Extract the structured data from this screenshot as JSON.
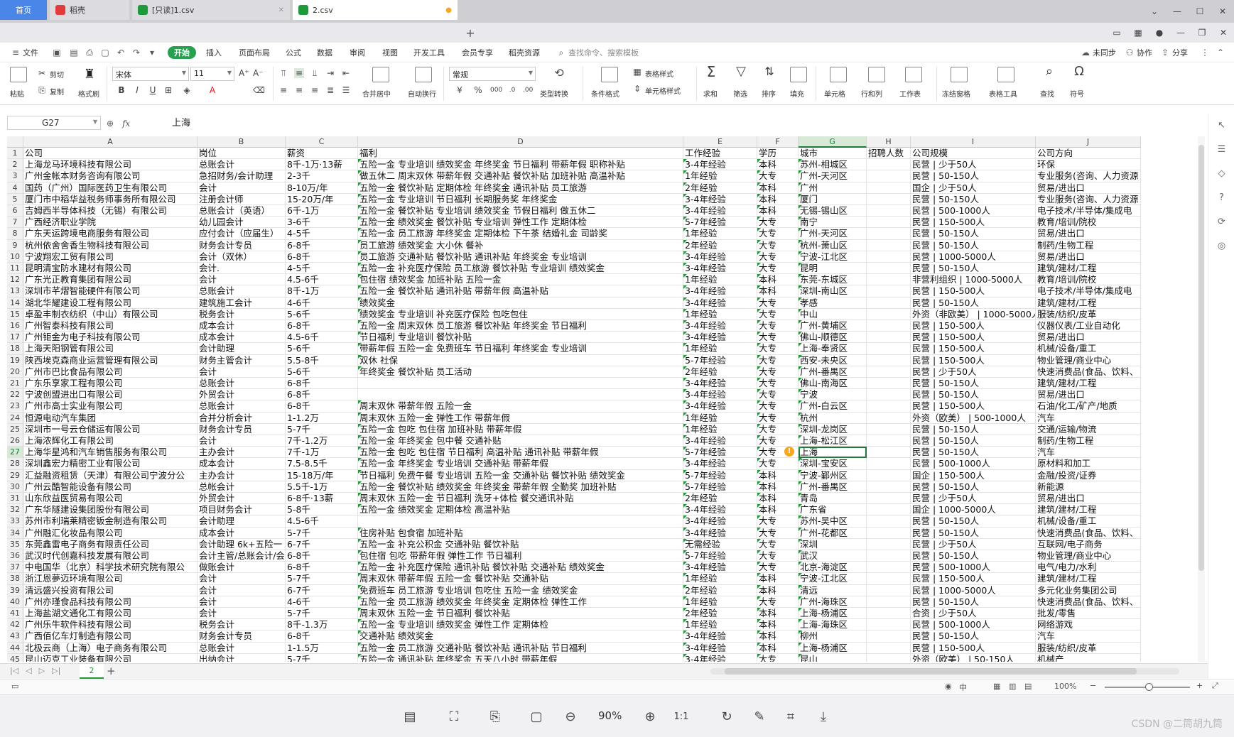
{
  "tabs": {
    "home": "首页",
    "docer": "稻壳",
    "file1": "[只读]1.csv",
    "file2": "2.csv"
  },
  "menu": {
    "file": "文件",
    "items": [
      "开始",
      "插入",
      "页面布局",
      "公式",
      "数据",
      "审阅",
      "视图",
      "开发工具",
      "会员专享",
      "稻壳资源"
    ],
    "search": "查找命令、搜索模板",
    "unsynced": "未同步",
    "collab": "协作",
    "share": "分享"
  },
  "ribbon": {
    "paste": "粘贴",
    "cut": "剪切",
    "copy": "复制",
    "format_painter": "格式刷",
    "font_name": "宋体",
    "font_size": "11",
    "merge": "合并居中",
    "wrap": "自动换行",
    "number_format": "常规",
    "type_convert": "类型转换",
    "cond_format": "条件格式",
    "table_style": "表格样式",
    "cell_style": "单元格样式",
    "sum": "求和",
    "filter": "筛选",
    "sort": "排序",
    "fill": "填充",
    "cell": "单元格",
    "rowcol": "行和列",
    "sheet": "工作表",
    "freeze": "冻结窗格",
    "table_tools": "表格工具",
    "find": "查找",
    "symbol": "符号"
  },
  "formula_bar": {
    "name_box": "G27",
    "content": "上海"
  },
  "columns": [
    "A",
    "B",
    "C",
    "D",
    "E",
    "F",
    "G",
    "H",
    "I",
    "J"
  ],
  "selected_column": "G",
  "rows": [
    [
      "公司",
      "岗位",
      "薪资",
      "福利",
      "工作经验",
      "学历",
      "城市",
      "招聘人数",
      "公司规模",
      "公司方向"
    ],
    [
      "上海龙马环境科技有限公司",
      "总账会计",
      "8千-1万·13薪",
      "五险一金 专业培训 绩效奖金 年终奖金 节日福利 带薪年假 职称补贴",
      "3-4年经验",
      "本科",
      "苏州-相城区",
      "",
      "民营 | 少于50人",
      "环保"
    ],
    [
      "广州金帐本财务咨询有限公司",
      "急招财务/会计助理",
      "2-3千",
      "做五休二 周末双休 带薪年假 交通补贴 餐饮补贴 加班补贴 高温补贴",
      "1年经验",
      "大专",
      "广州-天河区",
      "",
      "民营 | 50-150人",
      "专业服务(咨询、人力资源"
    ],
    [
      "国药（广州）国际医药卫生有限公司",
      "会计",
      "8-10万/年",
      "五险一金 餐饮补贴 定期体检 年终奖金 通讯补贴 员工旅游",
      "2年经验",
      "本科",
      "广州",
      "",
      "国企 | 少于50人",
      "贸易/进出口"
    ],
    [
      "厦门市中稻华益税务师事务所有限公司",
      "注册会计师",
      "15-20万/年",
      "五险一金 专业培训 节日福利 长期服务奖 年终奖金",
      "3-4年经验",
      "本科",
      "厦门",
      "",
      "民营 | 50-150人",
      "专业服务(咨询、人力资源"
    ],
    [
      "吉姆西半导体科技（无锡）有限公司",
      "总账会计（英语）",
      "6千-1万",
      "五险一金 餐饮补贴 专业培训 绩效奖金 节假日福利 做五休二",
      "3-4年经验",
      "本科",
      "无锡-锡山区",
      "",
      "民营 | 500-1000人",
      "电子技术/半导体/集成电"
    ],
    [
      "广西经济职业学院",
      "幼儿园会计",
      "3-6千",
      "五险一金 绩效奖金 餐饮补贴 专业培训 弹性工作 定期体检",
      "5-7年经验",
      "大专",
      "南宁",
      "",
      "民营 | 150-500人",
      "教育/培训/院校"
    ],
    [
      "广东天运跨境电商服务有限公司",
      "应付会计（应届生）",
      "4-5千",
      "五险一金 员工旅游 年终奖金 定期体检 下午茶 结婚礼金 司龄奖",
      "1年经验",
      "大专",
      "广州-天河区",
      "",
      "民营 | 50-150人",
      "贸易/进出口"
    ],
    [
      "杭州依舍舍香生物科技有限公司",
      "财务会计专员",
      "6-8千",
      "员工旅游 绩效奖金 大小休 餐补",
      "2年经验",
      "大专",
      "杭州-萧山区",
      "",
      "民营 | 50-150人",
      "制药/生物工程"
    ],
    [
      "宁波翔宏工贸有限公司",
      "会计（双休）",
      "6-8千",
      "员工旅游 交通补贴 餐饮补贴 通讯补贴 年终奖金 专业培训",
      "3-4年经验",
      "大专",
      "宁波-江北区",
      "",
      "民营 | 1000-5000人",
      "贸易/进出口"
    ],
    [
      "昆明清宝防水建材有限公司",
      "会计.",
      "4-5千",
      "五险一金 补充医疗保险 员工旅游 餐饮补贴 专业培训 绩效奖金",
      "3-4年经验",
      "大专",
      "昆明",
      "",
      "民营 | 50-150人",
      "建筑/建材/工程"
    ],
    [
      "广东光正教育集团有限公司",
      "会计",
      "4.5-6千",
      "包住宿 绩效奖金 加班补贴 五险一金",
      "1年经验",
      "本科",
      "东莞-东城区",
      "",
      "非营利组织 | 1000-5000人",
      "教育/培训/院校"
    ],
    [
      "深圳市芊熠智能硬件有限公司",
      "总账会计",
      "8千-1万",
      "五险一金 餐饮补贴 通讯补贴 带薪年假 高温补贴",
      "3-4年经验",
      "本科",
      "深圳-南山区",
      "",
      "民营 | 150-500人",
      "电子技术/半导体/集成电"
    ],
    [
      "湖北华耀建设工程有限公司",
      "建筑施工会计",
      "4-6千",
      "绩效奖金",
      "3-4年经验",
      "大专",
      "孝感",
      "",
      "民营 | 50-150人",
      "建筑/建材/工程"
    ],
    [
      "卓盈丰制衣纺织（中山）有限公司",
      "税务会计",
      "5-6千",
      "绩效奖金 专业培训 补充医疗保险 包吃包住",
      "1年经验",
      "大专",
      "中山",
      "",
      "外资（非欧美） | 1000-5000人",
      "服装/纺织/皮革"
    ],
    [
      "广州智泰科技有限公司",
      "成本会计",
      "6-8千",
      "五险一金 周末双休 员工旅游 餐饮补贴 年终奖金 节日福利",
      "3-4年经验",
      "大专",
      "广州-黄埔区",
      "",
      "民营 | 150-500人",
      "仪器仪表/工业自动化"
    ],
    [
      "广州钜金为电子科技有限公司",
      "成本会计",
      "4.5-6千",
      "节日福利 专业培训 餐饮补贴",
      "3-4年经验",
      "大专",
      "佛山-顺德区",
      "",
      "民营 | 150-500人",
      "贸易/进出口"
    ],
    [
      "上海天阳钢管有限公司",
      "会计助理",
      "5-6千",
      "带薪年假 五险一金 免费班车 节日福利 年终奖金 专业培训",
      "1年经验",
      "大专",
      "上海-奉贤区",
      "",
      "民营 | 150-500人",
      "机械/设备/重工"
    ],
    [
      "陕西埃克森商业运营管理有限公司",
      "财务主管会计",
      "5.5-8千",
      "双休 社保",
      "5-7年经验",
      "大专",
      "西安-未央区",
      "",
      "民营 | 150-500人",
      "物业管理/商业中心"
    ],
    [
      "广州市巴比食品有限公司",
      "会计",
      "5-6千",
      "年终奖金 餐饮补贴 员工活动",
      "2年经验",
      "大专",
      "广州-番禺区",
      "",
      "民营 | 少于50人",
      "快速消费品(食品、饮料、"
    ],
    [
      "广东乐享家工程有限公司",
      "总账会计",
      "6-8千",
      "",
      "3-4年经验",
      "大专",
      "佛山-南海区",
      "",
      "民营 | 50-150人",
      "建筑/建材/工程"
    ],
    [
      "宁波创盟进出口有限公司",
      "外贸会计",
      "6-8千",
      "",
      "3-4年经验",
      "大专",
      "宁波",
      "",
      "民营 | 50-150人",
      "贸易/进出口"
    ],
    [
      "广州市高士实业有限公司",
      "总账会计",
      "6-8千",
      "周末双休 带薪年假 五险一金",
      "3-4年经验",
      "大专",
      "广州-白云区",
      "",
      "民营 | 150-500人",
      "石油/化工/矿产/地质"
    ],
    [
      "恒源电动汽车集团",
      "合并分析会计",
      "1-1.2万",
      "周末双休 五险一金 弹性工作 带薪年假",
      "1年经验",
      "大专",
      "杭州",
      "",
      "外资（欧美） | 500-1000人",
      "汽车"
    ],
    [
      "深圳市一号云仓储运有限公司",
      "财务会计专员",
      "5-7千",
      "五险一金 包吃 包住宿 加班补贴 带薪年假",
      "1年经验",
      "大专",
      "深圳-龙岗区",
      "",
      "民营 | 50-150人",
      "交通/运输/物流"
    ],
    [
      "上海浓辉化工有限公司",
      "会计",
      "7千-1.2万",
      "五险一金 年终奖金 包中餐 交通补贴",
      "3-4年经验",
      "大专",
      "上海-松江区",
      "",
      "民营 | 50-150人",
      "制药/生物工程"
    ],
    [
      "上海华星鸿和汽车销售服务有限公司",
      "主办会计",
      "7千-1万",
      "五险一金 包吃 包住宿 节日福利 高温补贴 通讯补贴 带薪年假",
      "5-7年经验",
      "大专",
      "上海",
      "",
      "民营 | 50-150人",
      "汽车"
    ],
    [
      "深圳鑫宏力精密工业有限公司",
      "成本会计",
      "7.5-8.5千",
      "五险一金 年终奖金 专业培训 交通补贴 带薪年假",
      "3-4年经验",
      "大专",
      "深圳-宝安区",
      "",
      "民营 | 500-1000人",
      "原材料和加工"
    ],
    [
      "汇益融资租赁（天津）有限公司宁波分公",
      "主办会计",
      "15-18万/年",
      "节日福利 免费午餐 专业培训 五险一金 交通补贴 餐饮补贴 绩效奖金",
      "5-7年经验",
      "本科",
      "宁波-鄞州区",
      "",
      "国企 | 150-500人",
      "金融/投资/证券"
    ],
    [
      "广州云酷智能设备有限公司",
      "总帐会计",
      "5.5千-1万",
      "五险一金 餐饮补贴 绩效奖金 年终奖金 带薪年假 全勤奖 加班补贴",
      "5-7年经验",
      "本科",
      "广州-番禺区",
      "",
      "民营 | 50-150人",
      "新能源"
    ],
    [
      "山东欣益医贸易有限公司",
      "外贸会计",
      "6-8千·13薪",
      "周末双休 五险一金 节日福利 洗牙+体检 餐交通讯补贴",
      "2年经验",
      "本科",
      "青岛",
      "",
      "民营 | 少于50人",
      "贸易/进出口"
    ],
    [
      "广东华隧建设集团股份有限公司",
      "项目财务会计",
      "5-8千",
      "五险一金 绩效奖金 定期体检 高温补贴",
      "3-4年经验",
      "本科",
      "广东省",
      "",
      "国企 | 1000-5000人",
      "建筑/建材/工程"
    ],
    [
      "苏州市利瑞莱精密钣金制造有限公司",
      "会计助理",
      "4.5-6千",
      "",
      "3-4年经验",
      "大专",
      "苏州-吴中区",
      "",
      "民营 | 50-150人",
      "机械/设备/重工"
    ],
    [
      "广州融汇化妆品有限公司",
      "成本会计",
      "5-7千",
      "住房补贴 包食宿 加班补贴",
      "3-4年经验",
      "大专",
      "广州-花都区",
      "",
      "民营 | 50-150人",
      "快速消费品(食品、饮料、"
    ],
    [
      "东莞鑫雷电子商务有限责任公司",
      "会计助理 6k+五险一",
      "6-7千",
      "五险一金 补充公积金 交通补贴 餐饮补贴",
      "无需经验",
      "大专",
      "深圳",
      "",
      "民营 | 少于50人",
      "互联网/电子商务"
    ],
    [
      "武汉时代创嘉科技发展有限公司",
      "会计主管/总账会计/会",
      "6-8千",
      "包住宿 包吃 带薪年假 弹性工作 节日福利",
      "5-7年经验",
      "大专",
      "武汉",
      "",
      "民营 | 50-150人",
      "物业管理/商业中心"
    ],
    [
      "中电国华（北京）科学技术研究院有限公",
      "做账会计",
      "6-8千",
      "五险一金 补充医疗保险 通讯补贴 餐饮补贴 交通补贴 绩效奖金",
      "3-4年经验",
      "大专",
      "北京-海淀区",
      "",
      "民营 | 500-1000人",
      "电气/电力/水利"
    ],
    [
      "浙江恩夢迈环境有限公司",
      "会计",
      "5-7千",
      "周末双休 带薪年假 五险一金 餐饮补贴 交通补贴",
      "1年经验",
      "本科",
      "宁波-江北区",
      "",
      "民营 | 150-500人",
      "建筑/建材/工程"
    ],
    [
      "清远盛兴投资有限公司",
      "会计",
      "6-7千",
      "免费班车 员工旅游 专业培训 包吃住 五险一金 绩效奖金",
      "2年经验",
      "本科",
      "清远",
      "",
      "民营 | 1000-5000人",
      "多元化业务集团公司"
    ],
    [
      "广州亦瑾食品科技有限公司",
      "会计",
      "4-6千",
      "五险一金 员工旅游 绩效奖金 年终奖金 定期体检 弹性工作",
      "1年经验",
      "大专",
      "广州-海珠区",
      "",
      "民营 | 50-150人",
      "快速消费品(食品、饮料、"
    ],
    [
      "上海盐湖文通化工有限公司",
      "会计",
      "5-7千",
      "周末双休 五险一金 节日福利 餐饮补贴",
      "2年经验",
      "本科",
      "上海-杨浦区",
      "",
      "合资 | 少于50人",
      "批发/零售"
    ],
    [
      "广州乐牛软件科技有限公司",
      "税务会计",
      "8千-1.3万",
      "五险一金 专业培训 绩效奖金 弹性工作 定期体检",
      "1年经验",
      "本科",
      "上海-海珠区",
      "",
      "民营 | 500-1000人",
      "网络游戏"
    ],
    [
      "广西佰亿车灯制造有限公司",
      "财务会计专员",
      "6-8千",
      "交通补贴 绩效奖金",
      "3-4年经验",
      "本科",
      "柳州",
      "",
      "民营 | 50-150人",
      "汽车"
    ],
    [
      "北极云商（上海）电子商务有限公司",
      "总账会计",
      "1-1.5万",
      "五险一金 员工旅游 交通补贴 餐饮补贴 通讯补贴 节日福利",
      "3-4年经验",
      "本科",
      "上海-杨浦区",
      "",
      "民营 | 150-500人",
      "服装/纺织/皮革"
    ],
    [
      "昆山迈克工业装备有限公司",
      "出纳会计",
      "5-7千",
      "五险一金 通讯补贴 年终奖金 五天八小时 带薪年假",
      "3-4年经验",
      "大专",
      "昆山",
      "",
      "外资（欧美） | 50-150人",
      "机械产"
    ]
  ],
  "sheet": {
    "tab": "2"
  },
  "status": {
    "zoom": "100%"
  },
  "viewer": {
    "zoom": "90%",
    "watermark": "CSDN @二筒胡九筒"
  }
}
